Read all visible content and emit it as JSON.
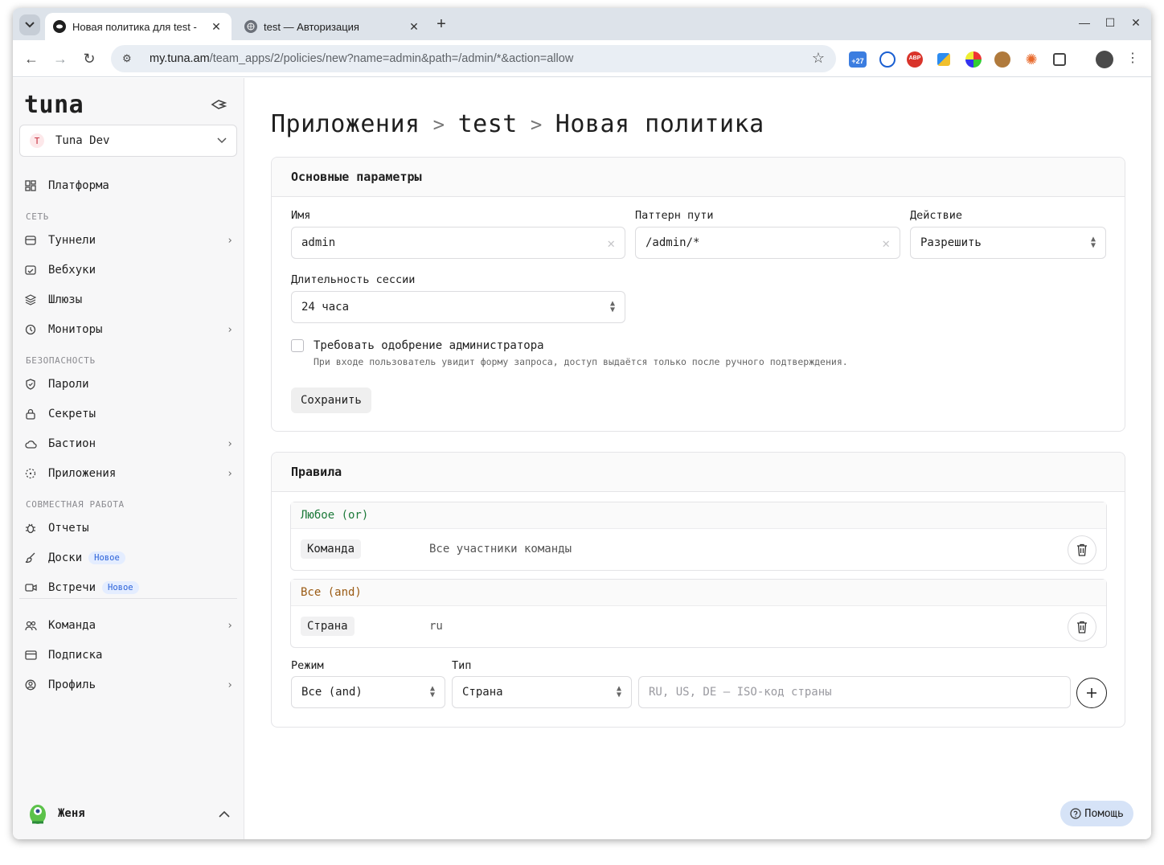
{
  "browser": {
    "tabs": [
      {
        "title": "Новая политика для test -",
        "active": true
      },
      {
        "title": "test — Авторизация",
        "active": false
      }
    ],
    "url_host": "my.tuna.am",
    "url_path": "/team_apps/2/policies/new?name=admin&path=/admin/*&action=allow",
    "extension_badge": "+27",
    "abp_label": "ABP"
  },
  "sidebar": {
    "logo": "tuna",
    "team": {
      "initial": "T",
      "name": "Tuna Dev"
    },
    "platform_label": "Платформа",
    "sections": {
      "network": "СЕТЬ",
      "security": "БЕЗОПАСНОСТЬ",
      "collab": "СОВМЕСТНАЯ РАБОТА"
    },
    "items": {
      "tunnels": "Туннели",
      "webhooks": "Вебхуки",
      "gateways": "Шлюзы",
      "monitors": "Мониторы",
      "passwords": "Пароли",
      "secrets": "Секреты",
      "bastion": "Бастион",
      "apps": "Приложения",
      "reports": "Отчеты",
      "boards": "Доски",
      "meetings": "Встречи",
      "team": "Команда",
      "subscription": "Подписка",
      "profile": "Профиль"
    },
    "new_badge": "Новое",
    "user_name": "Женя"
  },
  "main": {
    "breadcrumb": [
      "Приложения",
      "test",
      "Новая политика"
    ],
    "basic": {
      "title": "Основные параметры",
      "name_label": "Имя",
      "name_value": "admin",
      "path_label": "Паттерн пути",
      "path_value": "/admin/*",
      "action_label": "Действие",
      "action_value": "Разрешить",
      "session_label": "Длительность сессии",
      "session_value": "24 часа",
      "approval_label": "Требовать одобрение администратора",
      "approval_hint": "При входе пользователь увидит форму запроса, доступ выдаётся только после ручного подтверждения.",
      "save_label": "Сохранить"
    },
    "rules": {
      "title": "Правила",
      "groups": [
        {
          "mode": "Любое (or)",
          "type": "Команда",
          "value": "Все участники команды"
        },
        {
          "mode": "Все (and)",
          "type": "Страна",
          "value": "ru"
        }
      ],
      "mode_label": "Режим",
      "mode_value": "Все (and)",
      "type_label": "Тип",
      "type_value": "Страна",
      "value_placeholder": "RU, US, DE — ISO-код страны"
    },
    "help_label": "Помощь"
  }
}
